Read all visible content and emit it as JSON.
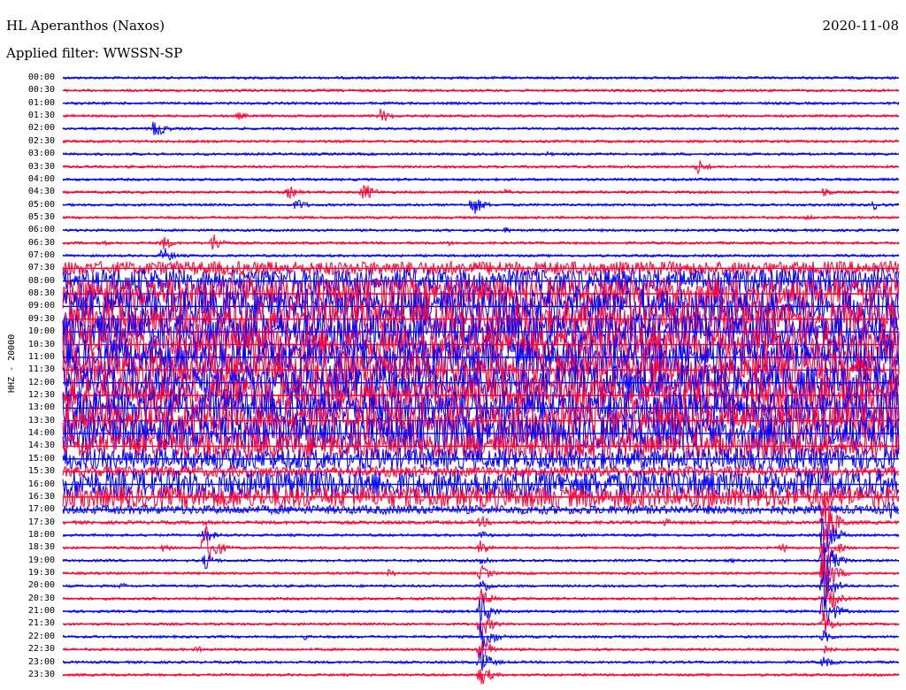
{
  "header": {
    "station": "HL Aperanthos (Naxos)",
    "date": "2020-11-08",
    "filter": "Applied filter: WWSSN-SP"
  },
  "colors": {
    "even": "#0000ff",
    "odd": "#ff0033"
  },
  "chart_data": {
    "type": "line",
    "title": "HL Aperanthos (Naxos)",
    "ylabel": "HHZ - 20000",
    "xlabel": "",
    "grid": false,
    "rows": [
      {
        "label": "00:00",
        "noise": 1.5,
        "events": [
          {
            "x": 0.21,
            "amp": 4
          },
          {
            "x": 0.61,
            "amp": 2
          }
        ]
      },
      {
        "label": "00:30",
        "noise": 1.5,
        "events": []
      },
      {
        "label": "01:00",
        "noise": 1.5,
        "events": [
          {
            "x": 0.73,
            "amp": 2
          }
        ]
      },
      {
        "label": "01:30",
        "noise": 1.5,
        "events": [
          {
            "x": 0.21,
            "amp": 5
          },
          {
            "x": 0.38,
            "amp": 9
          }
        ]
      },
      {
        "label": "02:00",
        "noise": 1.5,
        "events": [
          {
            "x": 0.11,
            "amp": 12
          }
        ]
      },
      {
        "label": "02:30",
        "noise": 1.5,
        "events": [
          {
            "x": 0.74,
            "amp": 2
          }
        ]
      },
      {
        "label": "03:00",
        "noise": 1.5,
        "events": [
          {
            "x": 0.58,
            "amp": 3
          },
          {
            "x": 0.89,
            "amp": 3
          }
        ]
      },
      {
        "label": "03:30",
        "noise": 1.5,
        "events": [
          {
            "x": 0.76,
            "amp": 9
          }
        ]
      },
      {
        "label": "04:00",
        "noise": 1.5,
        "events": []
      },
      {
        "label": "04:30",
        "noise": 1.5,
        "events": [
          {
            "x": 0.27,
            "amp": 8
          },
          {
            "x": 0.36,
            "amp": 12
          },
          {
            "x": 0.53,
            "amp": 4
          },
          {
            "x": 0.91,
            "amp": 6
          }
        ]
      },
      {
        "label": "05:00",
        "noise": 1.5,
        "events": [
          {
            "x": 0.28,
            "amp": 8
          },
          {
            "x": 0.49,
            "amp": 14
          },
          {
            "x": 0.97,
            "amp": 6
          }
        ]
      },
      {
        "label": "05:30",
        "noise": 1.5,
        "events": [
          {
            "x": 0.45,
            "amp": 2
          },
          {
            "x": 0.89,
            "amp": 4
          }
        ]
      },
      {
        "label": "06:00",
        "noise": 1.5,
        "events": [
          {
            "x": 0.53,
            "amp": 4
          }
        ]
      },
      {
        "label": "06:30",
        "noise": 1.5,
        "events": [
          {
            "x": 0.05,
            "amp": 3
          },
          {
            "x": 0.12,
            "amp": 9
          },
          {
            "x": 0.18,
            "amp": 12
          },
          {
            "x": 0.46,
            "amp": 4
          }
        ]
      },
      {
        "label": "07:00",
        "noise": 1.5,
        "events": [
          {
            "x": 0.12,
            "amp": 11
          }
        ]
      },
      {
        "label": "07:30",
        "noise": 8,
        "events": [
          {
            "x": 0.6,
            "amp": 12
          }
        ]
      },
      {
        "label": "08:00",
        "noise": 14,
        "events": []
      },
      {
        "label": "08:30",
        "noise": 18,
        "events": []
      },
      {
        "label": "09:00",
        "noise": 20,
        "events": []
      },
      {
        "label": "09:30",
        "noise": 20,
        "events": []
      },
      {
        "label": "10:00",
        "noise": 20,
        "events": []
      },
      {
        "label": "10:30",
        "noise": 20,
        "events": []
      },
      {
        "label": "11:00",
        "noise": 20,
        "events": []
      },
      {
        "label": "11:30",
        "noise": 20,
        "events": []
      },
      {
        "label": "12:00",
        "noise": 20,
        "events": []
      },
      {
        "label": "12:30",
        "noise": 20,
        "events": []
      },
      {
        "label": "13:00",
        "noise": 20,
        "events": []
      },
      {
        "label": "13:30",
        "noise": 20,
        "events": []
      },
      {
        "label": "14:00",
        "noise": 20,
        "events": []
      },
      {
        "label": "14:30",
        "noise": 16,
        "events": []
      },
      {
        "label": "15:00",
        "noise": 12,
        "events": [
          {
            "x": 0.91,
            "amp": 10
          }
        ]
      },
      {
        "label": "15:30",
        "noise": 6,
        "events": [
          {
            "x": 0.91,
            "amp": 18
          }
        ]
      },
      {
        "label": "16:00",
        "noise": 16,
        "events": [
          {
            "x": 0.91,
            "amp": 30
          }
        ]
      },
      {
        "label": "16:30",
        "noise": 12,
        "events": [
          {
            "x": 0.96,
            "amp": 12
          }
        ]
      },
      {
        "label": "17:00",
        "noise": 5,
        "events": [
          {
            "x": 0.69,
            "amp": 4
          },
          {
            "x": 0.99,
            "amp": 12
          }
        ]
      },
      {
        "label": "17:30",
        "noise": 2,
        "events": [
          {
            "x": 0.17,
            "amp": 4
          },
          {
            "x": 0.5,
            "amp": 8
          },
          {
            "x": 0.72,
            "amp": 5
          },
          {
            "x": 0.91,
            "amp": 40
          }
        ]
      },
      {
        "label": "18:00",
        "noise": 1.5,
        "events": [
          {
            "x": 0.17,
            "amp": 10
          },
          {
            "x": 0.5,
            "amp": 6
          },
          {
            "x": 0.91,
            "amp": 30
          }
        ]
      },
      {
        "label": "18:30",
        "noise": 1.5,
        "events": [
          {
            "x": 0.12,
            "amp": 5
          },
          {
            "x": 0.17,
            "amp": 30
          },
          {
            "x": 0.5,
            "amp": 10
          },
          {
            "x": 0.86,
            "amp": 6
          },
          {
            "x": 0.91,
            "amp": 30
          }
        ]
      },
      {
        "label": "19:00",
        "noise": 1.5,
        "events": [
          {
            "x": 0.17,
            "amp": 10
          },
          {
            "x": 0.5,
            "amp": 8
          },
          {
            "x": 0.8,
            "amp": 3
          },
          {
            "x": 0.91,
            "amp": 30
          }
        ]
      },
      {
        "label": "19:30",
        "noise": 1.5,
        "events": [
          {
            "x": 0.39,
            "amp": 5
          },
          {
            "x": 0.5,
            "amp": 10
          },
          {
            "x": 0.91,
            "amp": 30
          }
        ]
      },
      {
        "label": "20:00",
        "noise": 1.5,
        "events": [
          {
            "x": 0.07,
            "amp": 4
          },
          {
            "x": 0.5,
            "amp": 10
          },
          {
            "x": 0.91,
            "amp": 26
          }
        ]
      },
      {
        "label": "20:30",
        "noise": 1.5,
        "events": [
          {
            "x": 0.5,
            "amp": 12
          },
          {
            "x": 0.91,
            "amp": 26
          }
        ]
      },
      {
        "label": "21:00",
        "noise": 1.5,
        "events": [
          {
            "x": 0.5,
            "amp": 18
          },
          {
            "x": 0.91,
            "amp": 26
          }
        ]
      },
      {
        "label": "21:30",
        "noise": 1.5,
        "events": [
          {
            "x": 0.5,
            "amp": 18
          },
          {
            "x": 0.91,
            "amp": 14
          }
        ]
      },
      {
        "label": "22:00",
        "noise": 1.5,
        "events": [
          {
            "x": 0.29,
            "amp": 4
          },
          {
            "x": 0.5,
            "amp": 24
          },
          {
            "x": 0.91,
            "amp": 8
          }
        ]
      },
      {
        "label": "22:30",
        "noise": 1.5,
        "events": [
          {
            "x": 0.16,
            "amp": 4
          },
          {
            "x": 0.5,
            "amp": 18
          },
          {
            "x": 0.91,
            "amp": 6
          }
        ]
      },
      {
        "label": "23:00",
        "noise": 1.5,
        "events": [
          {
            "x": 0.5,
            "amp": 16
          },
          {
            "x": 0.91,
            "amp": 8
          }
        ]
      },
      {
        "label": "23:30",
        "noise": 1.5,
        "events": [
          {
            "x": 0.5,
            "amp": 14
          }
        ]
      }
    ]
  }
}
